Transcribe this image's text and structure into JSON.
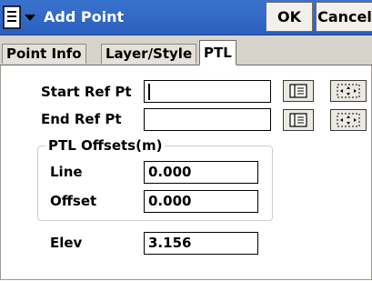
{
  "window": {
    "title": "Add Point",
    "menu_icon": "list-menu-icon",
    "ok_label": "OK",
    "cancel_label": "Cancel"
  },
  "tabs": [
    {
      "label": "Point Info",
      "active": false
    },
    {
      "label": "Layer/Style",
      "active": false
    },
    {
      "label": "PTL",
      "active": true
    }
  ],
  "form": {
    "start_ref_pt": {
      "label": "Start Ref Pt",
      "value": ""
    },
    "end_ref_pt": {
      "label": "End Ref Pt",
      "value": ""
    },
    "ptl_offsets": {
      "group_label": "PTL Offsets(m)",
      "line": {
        "label": "Line",
        "value": "0.000"
      },
      "offset": {
        "label": "Offset",
        "value": "0.000"
      }
    },
    "elev": {
      "label": "Elev",
      "value": "3.156"
    },
    "list_button_icon": "point-list-icon",
    "map_button_icon": "map-select-icon"
  },
  "colors": {
    "titlebar": "#2f66c6",
    "tabbar": "#d7d4cb",
    "button_face": "#f2f0ea"
  }
}
